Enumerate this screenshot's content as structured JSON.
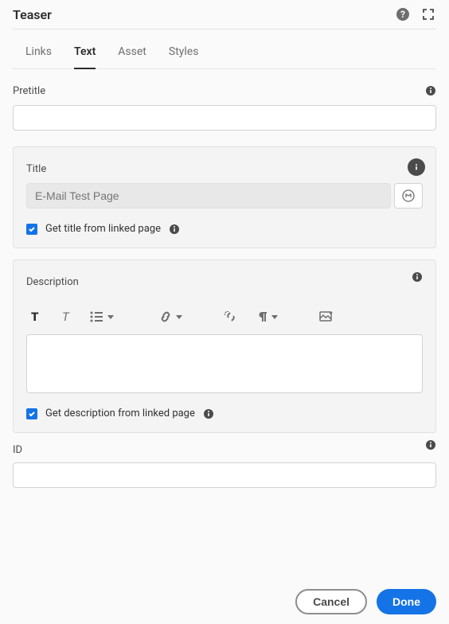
{
  "header": {
    "title": "Teaser"
  },
  "tabs": [
    "Links",
    "Text",
    "Asset",
    "Styles"
  ],
  "pretitle": {
    "label": "Pretitle",
    "value": ""
  },
  "title_section": {
    "label": "Title",
    "placeholder": "E-Mail Test Page",
    "checkbox_label": "Get title from linked page"
  },
  "description_section": {
    "label": "Description",
    "checkbox_label": "Get description from linked page"
  },
  "id_section": {
    "label": "ID",
    "value": ""
  },
  "footer": {
    "cancel": "Cancel",
    "done": "Done"
  }
}
